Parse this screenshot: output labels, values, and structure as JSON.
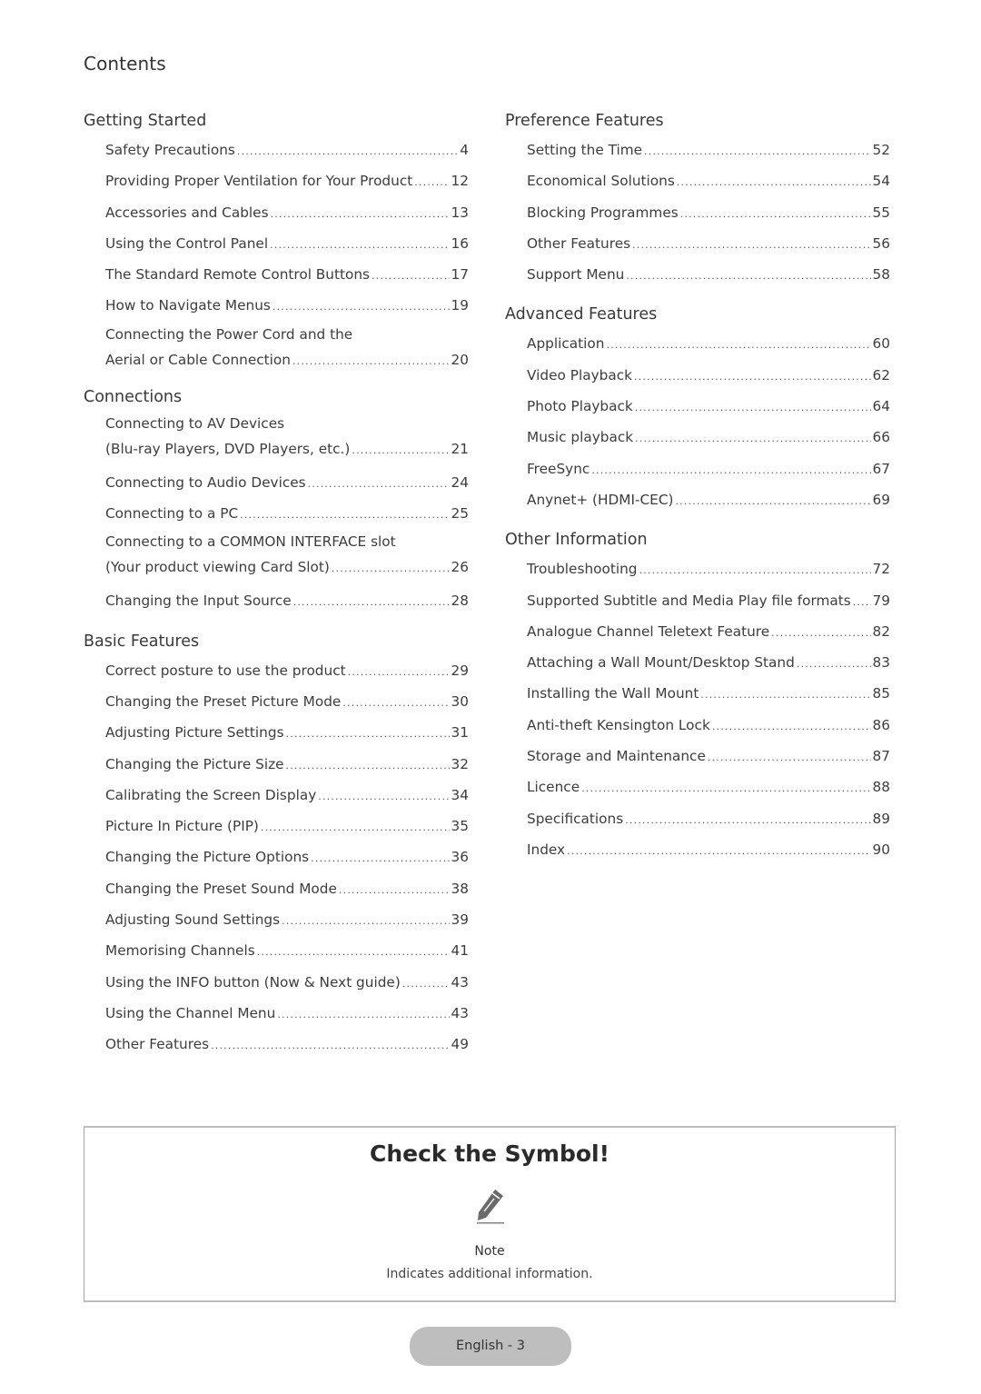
{
  "page_title": "Contents",
  "left_column": [
    {
      "title": "Getting Started",
      "entries": [
        {
          "label": "Safety Precautions",
          "page": "4"
        },
        {
          "label": "Providing Proper Ventilation for Your Product",
          "page": "12"
        },
        {
          "label": "Accessories and Cables",
          "page": "13"
        },
        {
          "label": "Using the Control Panel",
          "page": "16"
        },
        {
          "label": "The Standard Remote Control Buttons",
          "page": "17"
        },
        {
          "label": "How to Navigate Menus",
          "page": "19"
        },
        {
          "pre": "Connecting the Power Cord and the",
          "label": "Aerial or Cable Connection",
          "page": "20"
        }
      ]
    },
    {
      "title": "Connections",
      "entries": [
        {
          "pre": "Connecting to AV Devices",
          "label": "(Blu-ray Players, DVD Players, etc.)",
          "page": "21"
        },
        {
          "label": "Connecting to Audio Devices",
          "page": "24"
        },
        {
          "label": "Connecting to a PC",
          "page": "25"
        },
        {
          "pre": "Connecting to a COMMON INTERFACE slot",
          "label": "(Your product viewing Card Slot)",
          "page": "26"
        },
        {
          "label": "Changing the Input Source",
          "page": "28"
        }
      ]
    },
    {
      "title": "Basic Features",
      "entries": [
        {
          "label": "Correct posture to use the product",
          "page": "29"
        },
        {
          "label": "Changing the Preset Picture Mode",
          "page": "30"
        },
        {
          "label": "Adjusting Picture Settings",
          "page": "31"
        },
        {
          "label": "Changing the Picture Size",
          "page": "32"
        },
        {
          "label": "Calibrating the Screen Display",
          "page": "34"
        },
        {
          "label": "Picture In Picture (PIP)",
          "page": "35"
        },
        {
          "label": "Changing the Picture Options",
          "page": "36"
        },
        {
          "label": "Changing the Preset Sound Mode",
          "page": "38"
        },
        {
          "label": "Adjusting Sound Settings",
          "page": "39"
        },
        {
          "label": "Memorising Channels",
          "page": "41"
        },
        {
          "label": "Using the INFO button (Now & Next guide)",
          "page": "43"
        },
        {
          "label": "Using the Channel Menu",
          "page": "43"
        },
        {
          "label": "Other Features",
          "page": "49"
        }
      ]
    }
  ],
  "right_column": [
    {
      "title": "Preference Features",
      "entries": [
        {
          "label": "Setting the Time",
          "page": "52"
        },
        {
          "label": "Economical Solutions",
          "page": "54"
        },
        {
          "label": "Blocking Programmes",
          "page": "55"
        },
        {
          "label": "Other Features",
          "page": "56"
        },
        {
          "label": "Support Menu",
          "page": "58"
        }
      ]
    },
    {
      "title": "Advanced Features",
      "entries": [
        {
          "label": "Application",
          "page": "60"
        },
        {
          "label": "Video Playback",
          "page": "62"
        },
        {
          "label": "Photo Playback",
          "page": "64"
        },
        {
          "label": "Music playback",
          "page": "66"
        },
        {
          "label": "FreeSync",
          "page": "67"
        },
        {
          "label": "Anynet+ (HDMI-CEC)",
          "page": "69"
        }
      ]
    },
    {
      "title": "Other Information",
      "entries": [
        {
          "label": "Troubleshooting",
          "page": "72"
        },
        {
          "label": "Supported Subtitle and Media Play file formats",
          "page": "79"
        },
        {
          "label": "Analogue Channel Teletext Feature",
          "page": "82"
        },
        {
          "label": "Attaching a Wall Mount/Desktop Stand",
          "page": "83"
        },
        {
          "label": "Installing the Wall Mount",
          "page": "85"
        },
        {
          "label": "Anti-theft Kensington Lock",
          "page": "86"
        },
        {
          "label": "Storage and Maintenance",
          "page": "87"
        },
        {
          "label": "Licence",
          "page": "88"
        },
        {
          "label": "Specifications",
          "page": "89"
        },
        {
          "label": "Index",
          "page": "90"
        }
      ]
    }
  ],
  "check_symbol": {
    "title": "Check the Symbol!",
    "icon": "pencil-note-icon",
    "note_label": "Note",
    "note_description": "Indicates additional information."
  },
  "footer": {
    "page_label": "English - 3"
  }
}
